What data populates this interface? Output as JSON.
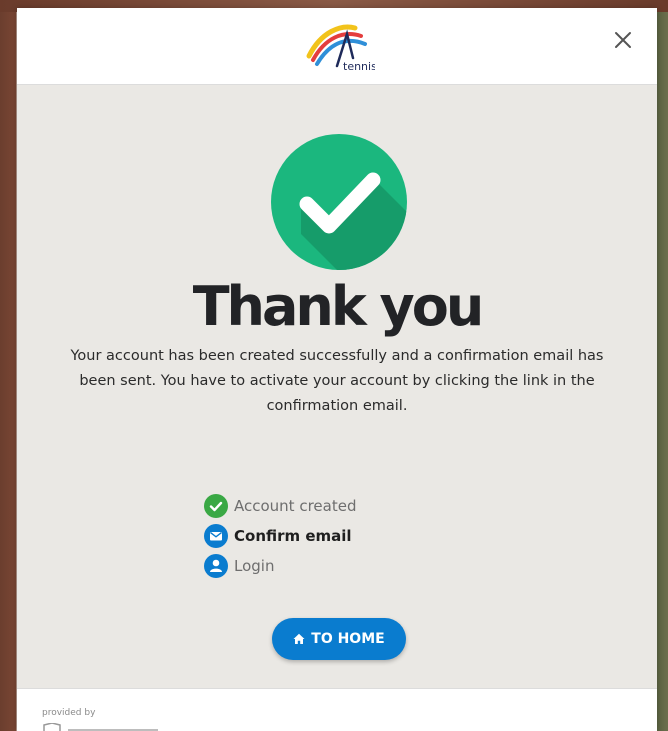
{
  "header": {
    "logo_text": "tennis",
    "close_label": "×"
  },
  "main": {
    "title": "Thank you",
    "message": "Your account has been created successfully and a confirmation email has been sent. You have to activate your account by clicking the link in the confirmation email.",
    "steps": [
      {
        "label": "Account created",
        "state": "done",
        "icon": "check-icon"
      },
      {
        "label": "Confirm email",
        "state": "active",
        "icon": "mail-icon"
      },
      {
        "label": "Login",
        "state": "pending",
        "icon": "user-icon"
      }
    ],
    "home_button_label": "TO HOME"
  },
  "footer": {
    "provided_by": "provided by"
  },
  "colors": {
    "success_green": "#1bb77e",
    "step_green": "#3aa844",
    "primary_blue": "#0a7ccf",
    "body_bg": "#eae8e4"
  }
}
